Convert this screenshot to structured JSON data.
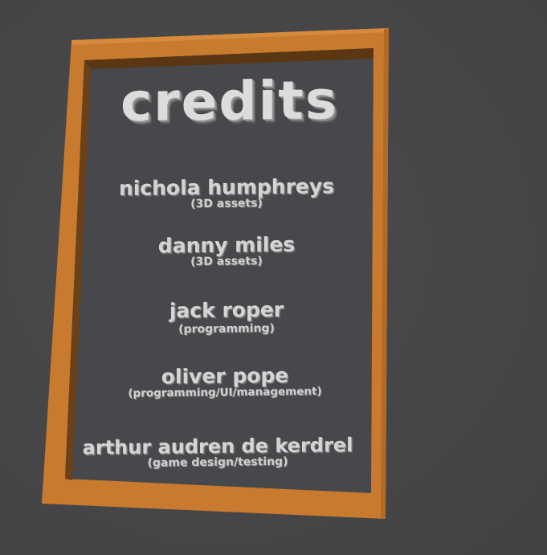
{
  "scene": {
    "background_color": "#474749",
    "frame_color": "#c77a2e",
    "board_color": "#47484b"
  },
  "title": "credits",
  "credits": [
    {
      "name": "nichola humphreys",
      "role": "(3D assets)"
    },
    {
      "name": "danny miles",
      "role": "(3D assets)"
    },
    {
      "name": "jack roper",
      "role": "(programming)"
    },
    {
      "name": "oliver pope",
      "role": "(programming/UI/management)"
    },
    {
      "name": "arthur audren de kerdrel",
      "role": "(game design/testing)"
    }
  ]
}
